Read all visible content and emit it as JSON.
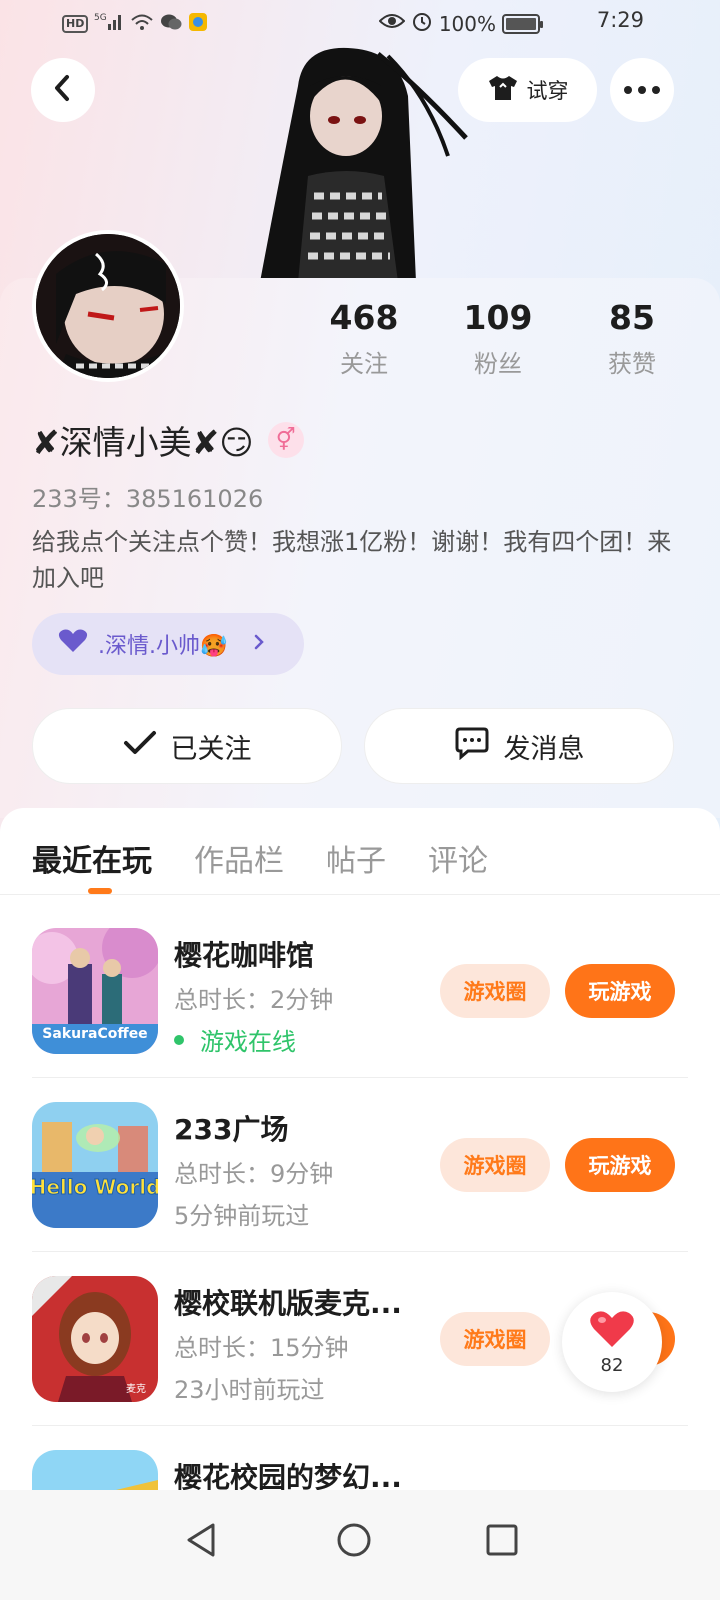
{
  "status_bar": {
    "left_text": "HD",
    "network": "5G",
    "battery_percent": "100%",
    "time": "7:29"
  },
  "header": {
    "tryon_label": "试穿"
  },
  "profile": {
    "stats": [
      {
        "value": "468",
        "label": "关注"
      },
      {
        "value": "109",
        "label": "粉丝"
      },
      {
        "value": "85",
        "label": "获赞"
      }
    ],
    "nickname": "✘深情小美✘😏",
    "gender_symbol": "⚥",
    "uid": "233号：385161026",
    "bio": "给我点个关注点个赞！我想涨1亿粉！谢谢！我有四个团！来加入吧",
    "group_chip": ".深情.小帅🥵",
    "follow_label": "已关注",
    "message_label": "发消息"
  },
  "tabs": [
    {
      "label": "最近在玩"
    },
    {
      "label": "作品栏"
    },
    {
      "label": "帖子"
    },
    {
      "label": "评论"
    }
  ],
  "games": [
    {
      "name": "樱花咖啡馆",
      "duration": "总时长：2分钟",
      "status": "游戏在线",
      "icon_text": "SakuraCoffee"
    },
    {
      "name": "233广场",
      "duration": "总时长：9分钟",
      "status": "5分钟前玩过",
      "icon_text": "Hello World"
    },
    {
      "name": "樱校联机版麦克...",
      "duration": "总时长：15分钟",
      "status": "23小时前玩过",
      "icon_text": "麦克"
    },
    {
      "name": "樱花校园的梦幻...",
      "duration": "",
      "status": "",
      "icon_text": ""
    }
  ],
  "game_buttons": {
    "circle_label": "游戏圈",
    "play_label": "玩游戏"
  },
  "like_float": {
    "count": "82"
  },
  "colors": {
    "accent": "#ff7418",
    "online": "#2fc46a",
    "group_chip": "#6a5acd"
  }
}
